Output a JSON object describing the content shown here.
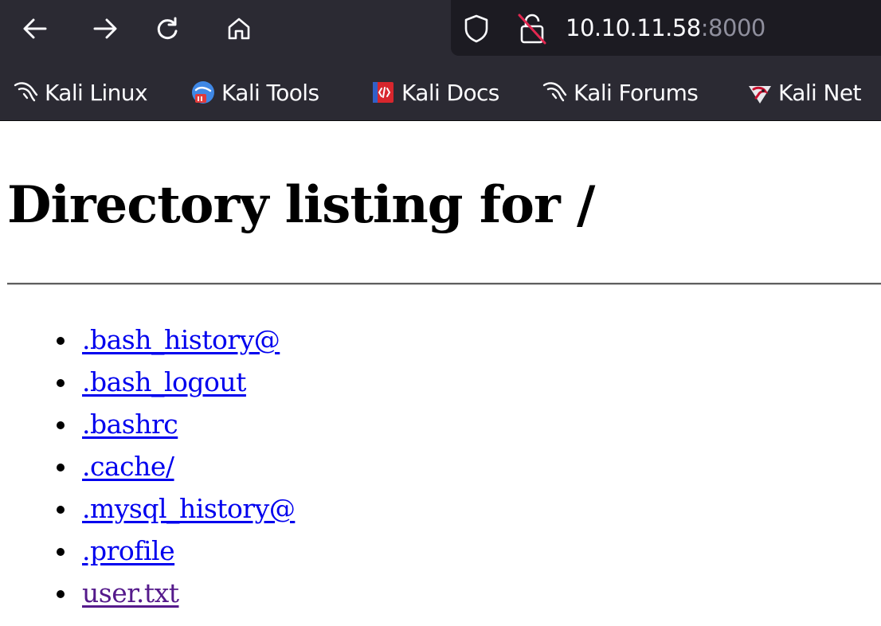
{
  "browser": {
    "url_host": "10.10.11.58",
    "url_port": ":8000",
    "bookmarks": [
      {
        "label": "Kali Linux",
        "icon": "kali-dragon-icon"
      },
      {
        "label": "Kali Tools",
        "icon": "kali-tools-icon"
      },
      {
        "label": "Kali Docs",
        "icon": "kali-docs-icon"
      },
      {
        "label": "Kali Forums",
        "icon": "kali-dragon-icon"
      },
      {
        "label": "Kali Net",
        "icon": "kali-nethunter-icon"
      }
    ]
  },
  "page": {
    "heading": "Directory listing for /",
    "entries": [
      {
        "name": ".bash_history@",
        "visited": false
      },
      {
        "name": ".bash_logout",
        "visited": false
      },
      {
        "name": ".bashrc",
        "visited": false
      },
      {
        "name": ".cache/",
        "visited": false
      },
      {
        "name": ".mysql_history@",
        "visited": false
      },
      {
        "name": ".profile",
        "visited": false
      },
      {
        "name": "user.txt",
        "visited": true
      }
    ]
  },
  "colors": {
    "link": "#0000ee",
    "visited_link": "#551a8b",
    "toolbar": "#2b2a33",
    "urlbar": "#1c1b22"
  }
}
